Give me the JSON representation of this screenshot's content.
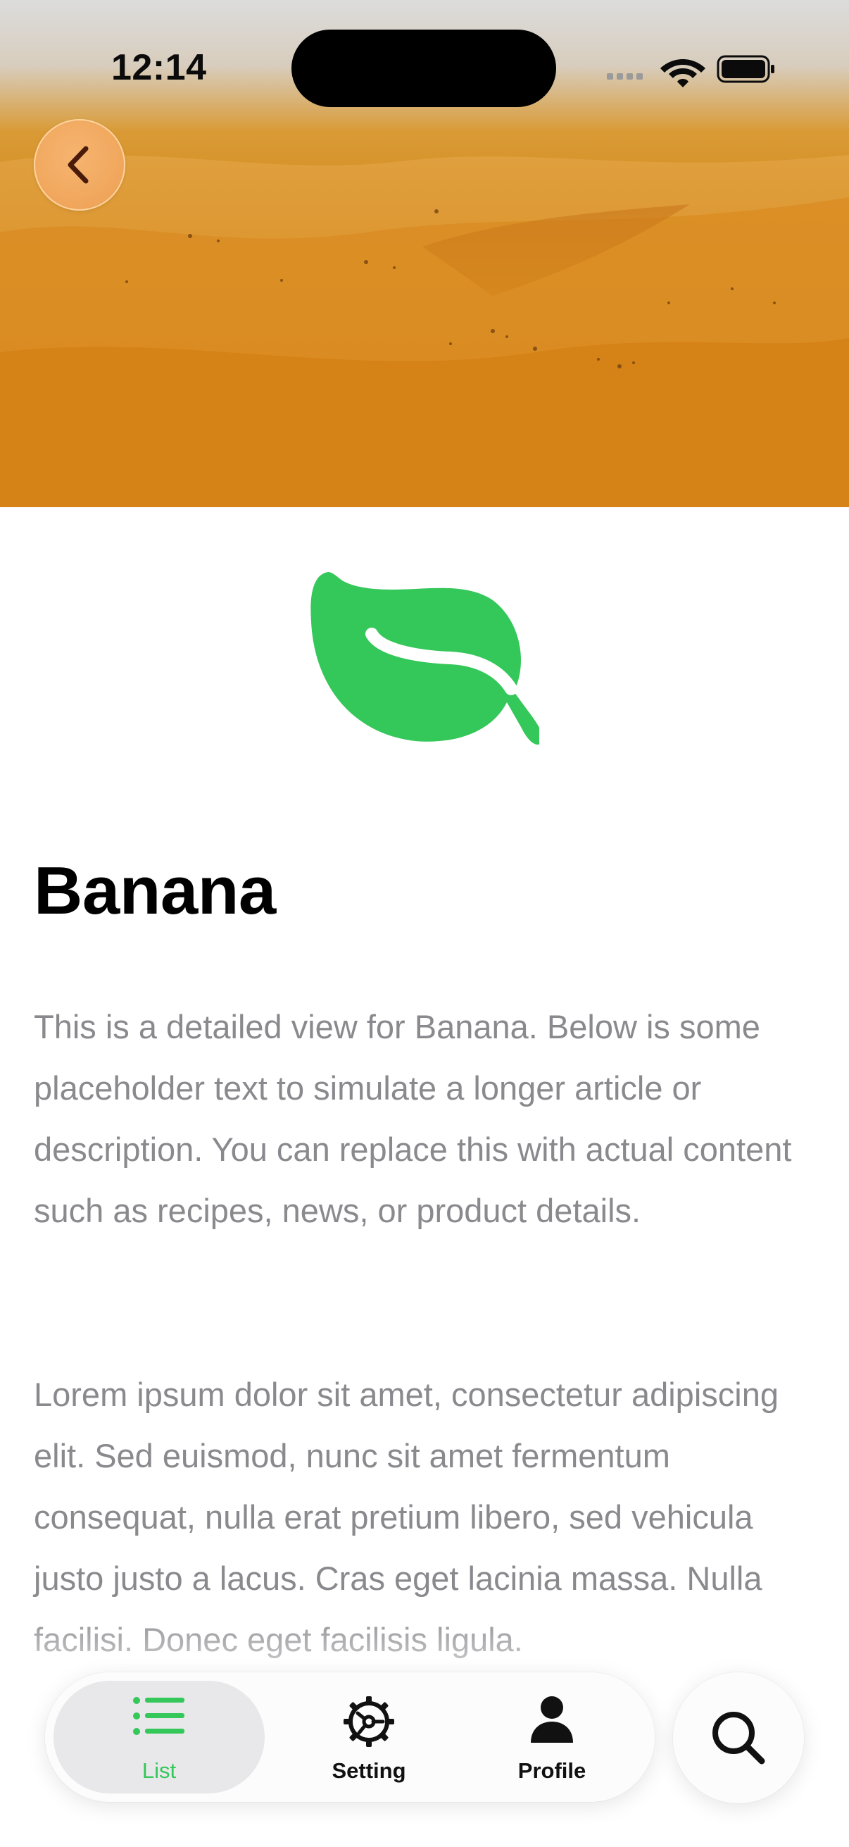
{
  "status_bar": {
    "time": "12:14"
  },
  "hero": {
    "image": "desert-sand-dunes"
  },
  "icons": {
    "back": "chevron-left-icon",
    "feature": "leaf-icon",
    "list": "list-bullet-icon",
    "setting": "gear-icon",
    "profile": "person-icon",
    "search": "magnifying-glass-icon"
  },
  "article": {
    "title": "Banana",
    "paragraphs": [
      "This is a detailed view for Banana. Below is some placeholder text to simulate a longer article or description. You can replace this with actual content such as recipes, news, or product details.",
      "Lorem ipsum dolor sit amet, consectetur adipiscing elit. Sed euismod, nunc sit amet fermentum consequat, nulla erat pretium libero, sed vehicula justo justo a lacus. Cras eget lacinia massa. Nulla facilisi. Donec eget facilisis ligula."
    ]
  },
  "tab_bar": {
    "tabs": [
      {
        "label": "List",
        "selected": true
      },
      {
        "label": "Setting",
        "selected": false
      },
      {
        "label": "Profile",
        "selected": false
      }
    ]
  },
  "colors": {
    "accent": "#34c759",
    "text_primary": "#000000",
    "text_secondary": "#8a8a8e",
    "back_button": "#f1a85e"
  }
}
